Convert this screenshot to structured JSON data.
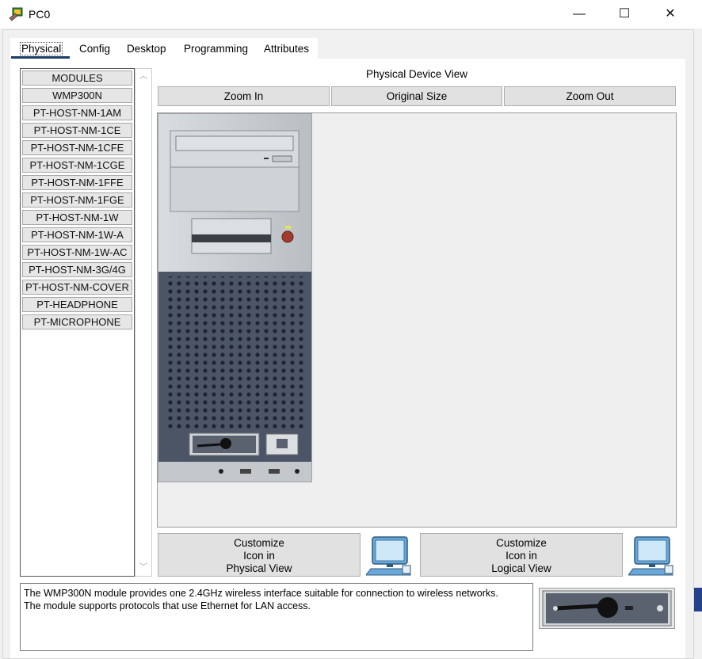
{
  "window": {
    "title": "PC0",
    "controls": {
      "minimize": "—",
      "maximize": "☐",
      "close": "✕"
    }
  },
  "tabs": [
    {
      "label": "Physical",
      "active": true
    },
    {
      "label": "Config"
    },
    {
      "label": "Desktop"
    },
    {
      "label": "Programming"
    },
    {
      "label": "Attributes"
    }
  ],
  "modules": {
    "items": [
      "MODULES",
      "WMP300N",
      "PT-HOST-NM-1AM",
      "PT-HOST-NM-1CE",
      "PT-HOST-NM-1CFE",
      "PT-HOST-NM-1CGE",
      "PT-HOST-NM-1FFE",
      "PT-HOST-NM-1FGE",
      "PT-HOST-NM-1W",
      "PT-HOST-NM-1W-A",
      "PT-HOST-NM-1W-AC",
      "PT-HOST-NM-3G/4G",
      "PT-HOST-NM-COVER",
      "PT-HEADPHONE",
      "PT-MICROPHONE"
    ]
  },
  "device_view": {
    "title": "Physical Device View",
    "zoom_in": "Zoom In",
    "original_size": "Original Size",
    "zoom_out": "Zoom Out"
  },
  "customize": {
    "physical": {
      "line1": "Customize",
      "line2": "Icon in",
      "line3": "Physical View"
    },
    "logical": {
      "line1": "Customize",
      "line2": "Icon in",
      "line3": "Logical View"
    }
  },
  "description": {
    "line1": "The WMP300N module provides one 2.4GHz wireless interface suitable for connection to wireless networks.",
    "line2": "The module supports protocols that use Ethernet for LAN access."
  },
  "colors": {
    "accent": "#1f3b66",
    "case_silver": "#c8cdd1",
    "case_grille": "#4c5566"
  }
}
